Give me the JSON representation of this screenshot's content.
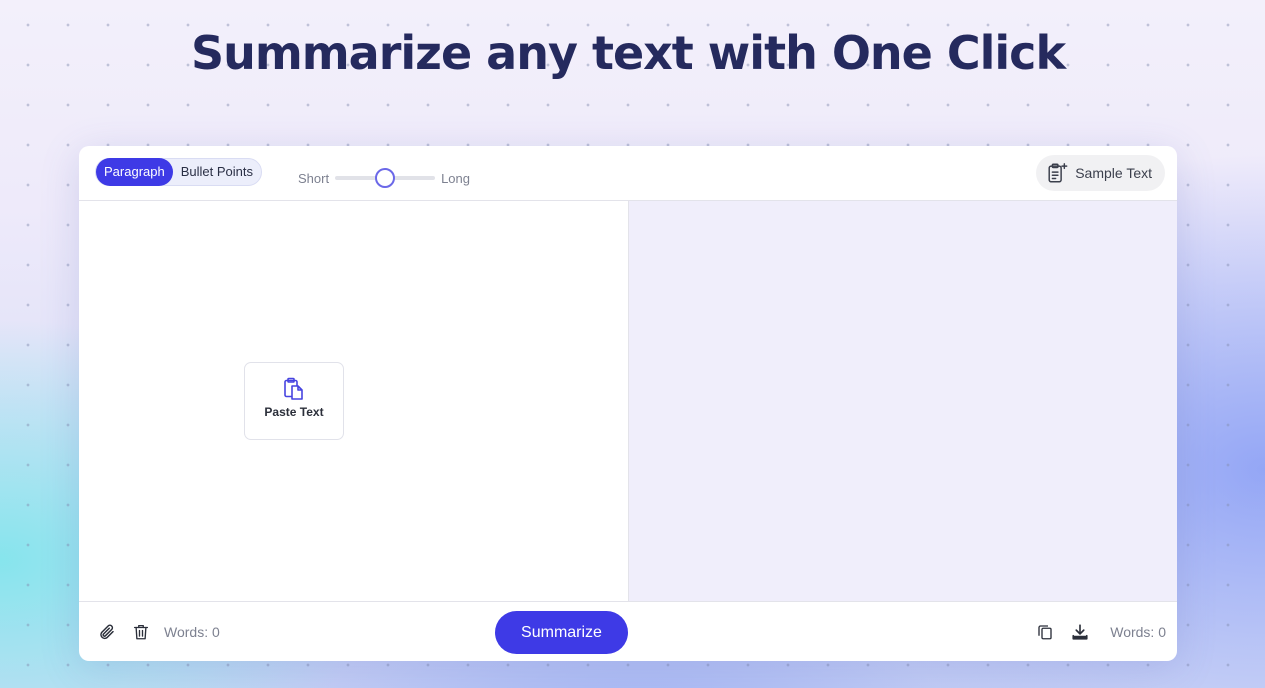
{
  "page": {
    "headline": "Summarize any text with One Click"
  },
  "toolbar": {
    "modes": [
      {
        "label": "Paragraph",
        "active": true
      },
      {
        "label": "Bullet Points",
        "active": false
      }
    ],
    "length": {
      "short_label": "Short",
      "long_label": "Long",
      "level": 0.5
    },
    "sample_text_label": "Sample Text"
  },
  "input": {
    "paste_label": "Paste Text",
    "words_label": "Words: 0"
  },
  "output": {
    "words_label": "Words: 0"
  },
  "actions": {
    "summarize_label": "Summarize"
  },
  "colors": {
    "accent": "#3e3ae6",
    "headline": "#252a5e",
    "output_bg": "#f0eefb"
  },
  "icons": {
    "sample": "clipboard-plus-icon",
    "paste": "clipboard-paste-icon",
    "attach": "paperclip-icon",
    "delete": "trash-icon",
    "copy": "copy-icon",
    "download": "download-icon"
  }
}
